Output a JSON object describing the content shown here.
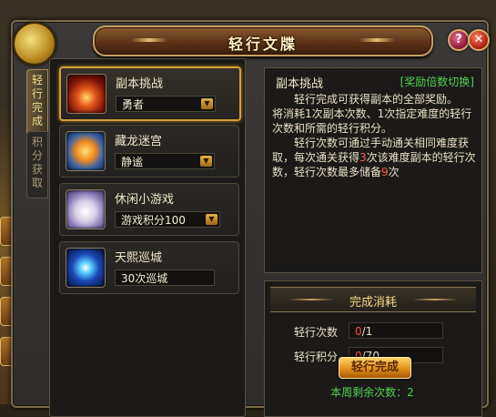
{
  "window": {
    "title": "轻行文牒",
    "help_label": "?",
    "close_label": "✕"
  },
  "side_tabs": [
    {
      "label": "轻行完成",
      "active": true
    },
    {
      "label": "积分获取",
      "active": false
    }
  ],
  "cards": [
    {
      "icon": "flame-sword-icon",
      "title": "副本挑战",
      "value": "勇者",
      "has_dropdown": true,
      "selected": true
    },
    {
      "icon": "fire-shield-icon",
      "title": "藏龙迷宫",
      "value": "静谧",
      "has_dropdown": true,
      "selected": false
    },
    {
      "icon": "cat-mascot-icon",
      "title": "休闲小游戏",
      "value": "游戏积分100",
      "has_dropdown": true,
      "selected": false
    },
    {
      "icon": "dragon-eye-icon",
      "title": "天熙巡城",
      "value": "30次巡城",
      "has_dropdown": false,
      "selected": false
    }
  ],
  "description": {
    "title": "副本挑战",
    "switch_link": "[奖励倍数切换]",
    "line1": "轻行完成可获得副本的全部奖励。",
    "line2": "将消耗1次副本次数、1次指定难度的轻行次数和所需的轻行积分。",
    "line3_a": "轻行次数可通过手动通关相同难度获取，每次通关获得",
    "line3_n1": "3",
    "line3_b": "次该难度副本的轻行次数，轻行次数最多储备",
    "line3_n2": "9",
    "line3_c": "次"
  },
  "cost": {
    "header": "完成消耗",
    "rows": [
      {
        "label": "轻行次数",
        "current": "0",
        "total": "/1"
      },
      {
        "label": "轻行积分",
        "current": "0",
        "total": "/70"
      }
    ],
    "complete_button": "轻行完成",
    "remaining_text": "本周剩余次数：2"
  },
  "colors": {
    "accent_gold": "#d2a03a",
    "link_green": "#4fd24f",
    "highlight_red": "#ff5a44"
  }
}
